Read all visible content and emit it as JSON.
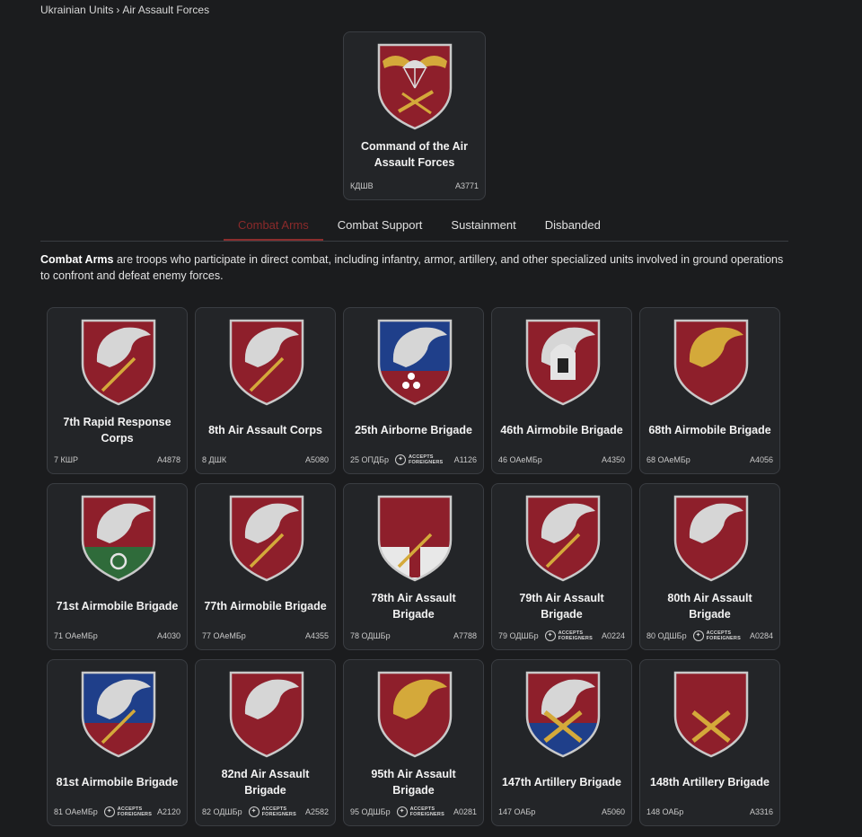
{
  "breadcrumb": {
    "root": "Ukrainian Units",
    "separator": "›",
    "current": "Air Assault Forces"
  },
  "headquarters": {
    "name": "Command of the Air Assault Forces",
    "abbr": "КДШВ",
    "code": "А3771"
  },
  "tabs": [
    {
      "label": "Combat Arms",
      "active": true
    },
    {
      "label": "Combat Support",
      "active": false
    },
    {
      "label": "Sustainment",
      "active": false
    },
    {
      "label": "Disbanded",
      "active": false
    }
  ],
  "description": {
    "term": "Combat Arms",
    "text": " are troops who participate in direct combat, including infantry, armor, artillery, and other specialized units involved in ground operations to confront and defeat enemy forces."
  },
  "badge": {
    "line1": "ACCEPTS",
    "line2": "FOREIGNERS"
  },
  "units": [
    {
      "name": "7th Rapid Response Corps",
      "abbr": "7 КШР",
      "code": "А4878",
      "foreigners": false,
      "emblem": "winged-hand-swords",
      "colors": [
        "#8e1f2b"
      ]
    },
    {
      "name": "8th Air Assault Corps",
      "abbr": "8 ДШК",
      "code": "А5080",
      "foreigners": false,
      "emblem": "eagle-head-swords",
      "colors": [
        "#8e1f2b"
      ]
    },
    {
      "name": "25th Airborne Brigade",
      "abbr": "25 ОПДБр",
      "code": "А1126",
      "foreigners": true,
      "emblem": "eagle-head-stars",
      "colors": [
        "#1f3f8a",
        "#8e1f2b"
      ]
    },
    {
      "name": "46th Airmobile Brigade",
      "abbr": "46 ОАеМБр",
      "code": "А4350",
      "foreigners": false,
      "emblem": "winged-helmet",
      "colors": [
        "#8e1f2b"
      ]
    },
    {
      "name": "68th Airmobile Brigade",
      "abbr": "68 ОАеМБр",
      "code": "А4056",
      "foreigners": false,
      "emblem": "golden-lion",
      "colors": [
        "#8e1f2b"
      ]
    },
    {
      "name": "71st Airmobile Brigade",
      "abbr": "71 ОАеМБр",
      "code": "А4030",
      "foreigners": false,
      "emblem": "griffin-horn",
      "colors": [
        "#8e1f2b",
        "#2f6b3a"
      ]
    },
    {
      "name": "77th Airmobile Brigade",
      "abbr": "77 ОАеМБр",
      "code": "А4355",
      "foreigners": false,
      "emblem": "winged-axe",
      "colors": [
        "#8e1f2b"
      ]
    },
    {
      "name": "78th Air Assault Brigade",
      "abbr": "78 ОДШБр",
      "code": "А7788",
      "foreigners": false,
      "emblem": "cross-axe",
      "colors": [
        "#8e1f2b",
        "#e8e8e8"
      ]
    },
    {
      "name": "79th Air Assault Brigade",
      "abbr": "79 ОДШБр",
      "code": "А0224",
      "foreigners": true,
      "emblem": "wing-sword",
      "colors": [
        "#8e1f2b"
      ]
    },
    {
      "name": "80th Air Assault Brigade",
      "abbr": "80 ОДШБр",
      "code": "А0284",
      "foreigners": true,
      "emblem": "silver-lion",
      "colors": [
        "#8e1f2b"
      ]
    },
    {
      "name": "81st Airmobile Brigade",
      "abbr": "81 ОАеМБр",
      "code": "А2120",
      "foreigners": true,
      "emblem": "griffin-sword",
      "colors": [
        "#1f3f8a",
        "#8e1f2b"
      ]
    },
    {
      "name": "82nd Air Assault Brigade",
      "abbr": "82 ОДШБр",
      "code": "А2582",
      "foreigners": true,
      "emblem": "spread-eagle",
      "colors": [
        "#8e1f2b"
      ]
    },
    {
      "name": "95th Air Assault Brigade",
      "abbr": "95 ОДШБр",
      "code": "А0281",
      "foreigners": true,
      "emblem": "golden-eagle",
      "colors": [
        "#8e1f2b"
      ]
    },
    {
      "name": "147th Artillery Brigade",
      "abbr": "147 ОАБр",
      "code": "А5060",
      "foreigners": false,
      "emblem": "winged-cannon",
      "colors": [
        "#8e1f2b",
        "#1f3f8a"
      ]
    },
    {
      "name": "148th Artillery Brigade",
      "abbr": "148 ОАБр",
      "code": "А3316",
      "foreigners": false,
      "emblem": "crossed-cannons",
      "colors": [
        "#8e1f2b"
      ]
    }
  ]
}
